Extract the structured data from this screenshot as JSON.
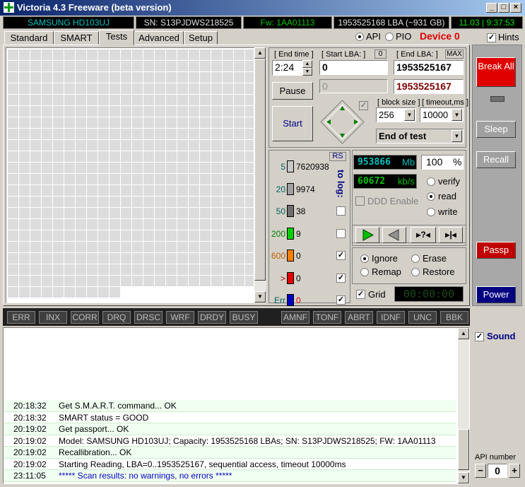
{
  "window": {
    "title": "Victoria 4.3 Freeware (beta version)"
  },
  "info": {
    "model": "SAMSUNG HD103UJ",
    "serial": "SN: S13PJDWS218525",
    "firmware": "Fw: 1AA01113",
    "lba": "1953525168 LBA (~931 GB)",
    "datetime": "11.03 | 9:37:53"
  },
  "tabs": [
    "Standard",
    "SMART",
    "Tests",
    "Advanced",
    "Setup"
  ],
  "mode": {
    "api": "API",
    "pio": "PIO",
    "device": "Device 0",
    "hints": "Hints"
  },
  "test": {
    "end_time_label": "[ End time ]",
    "end_time": "2:24",
    "start_lba_label": "[ Start LBA: ]",
    "start_lba_btn": "0",
    "start_lba": "0",
    "end_lba_label": "[ End LBA: ]",
    "max_btn": "MAX",
    "end_lba": "1953525167",
    "end_lba2": "1953525167",
    "current_lba": "0",
    "pause": "Pause",
    "start": "Start",
    "block_size_label": "[ block size ]",
    "block_size": "256",
    "timeout_label": "[ timeout,ms ]",
    "timeout": "10000",
    "end_action": "End of test"
  },
  "legend": {
    "rs": "RS",
    "to_log": "to log:",
    "rows": [
      {
        "label": "5",
        "count": "7620938",
        "color": "#c8c8c8"
      },
      {
        "label": "20",
        "count": "9974",
        "color": "#a0a0a0"
      },
      {
        "label": "50",
        "count": "38",
        "color": "#707070"
      },
      {
        "label": "200",
        "count": "9",
        "color": "#00d000"
      },
      {
        "label": "600",
        "count": "0",
        "color": "#ff8000"
      },
      {
        "label": ">",
        "count": "0",
        "color": "#e00000"
      },
      {
        "label": "Err",
        "count": "0",
        "color": "#0000c0"
      }
    ]
  },
  "stats": {
    "mb": "953866",
    "mb_unit": "Mb",
    "percent": "100",
    "percent_unit": "%",
    "speed": "60672",
    "speed_unit": "kb/s",
    "ddd": "DDD Enable",
    "verify": "verify",
    "read": "read",
    "write": "write"
  },
  "actions": {
    "ignore": "Ignore",
    "erase": "Erase",
    "remap": "Remap",
    "restore": "Restore",
    "grid": "Grid",
    "timer": "00:00:00"
  },
  "right_buttons": {
    "break": "Break All",
    "sleep": "Sleep",
    "recall": "Recall",
    "passp": "Passp",
    "power": "Power",
    "sound": "Sound",
    "api_number_label": "API number",
    "api_number": "0"
  },
  "flags": [
    "ERR",
    "INX",
    "CORR",
    "DRQ",
    "DRSC",
    "WRF",
    "DRDY",
    "BUSY",
    "AMNF",
    "TONF",
    "ABRT",
    "IDNF",
    "UNC",
    "BBK"
  ],
  "log": [
    {
      "time": "20:18:32",
      "msg": "Get S.M.A.R.T. command... OK",
      "color": "#000000"
    },
    {
      "time": "20:18:32",
      "msg": "SMART status = GOOD",
      "color": "#000000"
    },
    {
      "time": "20:19:02",
      "msg": "Get passport... OK",
      "color": "#000000"
    },
    {
      "time": "20:19:02",
      "msg": "Model: SAMSUNG HD103UJ; Capacity: 1953525168 LBAs; SN: S13PJDWS218525; FW: 1AA01113",
      "color": "#000000"
    },
    {
      "time": "20:19:02",
      "msg": "Recallibration... OK",
      "color": "#000000"
    },
    {
      "time": "20:19:02",
      "msg": "Starting Reading, LBA=0..1953525167, sequential access, timeout 10000ms",
      "color": "#000000"
    },
    {
      "time": "23:11:05",
      "msg": "***** Scan results: no warnings, no errors *****",
      "color": "#0000c0"
    }
  ]
}
